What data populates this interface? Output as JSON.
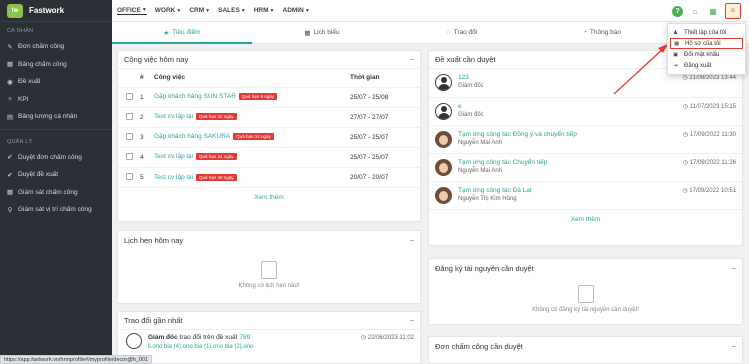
{
  "brand": {
    "name": "Fastwork",
    "logo_text": "fw"
  },
  "sidebar": {
    "section_personal": "CÁ NHÂN",
    "personal_items": [
      {
        "icon": "✎",
        "label": "Đơn chấm công"
      },
      {
        "icon": "▦",
        "label": "Bảng chấm công"
      },
      {
        "icon": "◉",
        "label": "Đề xuất"
      },
      {
        "icon": "✧",
        "label": "KPI"
      },
      {
        "icon": "▤",
        "label": "Bảng lương cá nhân"
      }
    ],
    "section_manage": "QUẢN LÝ",
    "manage_items": [
      {
        "icon": "✔",
        "label": "Duyệt đơn chấm công"
      },
      {
        "icon": "✔",
        "label": "Duyệt đề xuất"
      },
      {
        "icon": "▦",
        "label": "Giám sát chấm công"
      },
      {
        "icon": "⚲",
        "label": "Giám sát vị trí chấm công"
      }
    ]
  },
  "menu": [
    "OFFICE",
    "WORK",
    "CRM",
    "SALES",
    "HRM",
    "ADMIN"
  ],
  "tabs": [
    {
      "icon": "★",
      "label": "Tiêu điểm"
    },
    {
      "icon": "▦",
      "label": "Lịch biểu"
    },
    {
      "icon": "◌",
      "label": "Trao đổi"
    },
    {
      "icon": "◔",
      "label": "Thông báo"
    }
  ],
  "tasks": {
    "title": "Công việc hôm nay",
    "col_no": "#",
    "col_task": "Công việc",
    "col_time": "Thời gian",
    "rows": [
      {
        "no": "1",
        "name": "Gặp khách hàng SUN STAR",
        "badge": "Quá hạn 9 ngày",
        "time": "25/07 - 25/08"
      },
      {
        "no": "2",
        "name": "Test cv lặp lại",
        "badge": "Quá hạn 32 ngày",
        "time": "27/07 - 27/07"
      },
      {
        "no": "3",
        "name": "Gặp khách hàng SAKURA",
        "badge": "Quá hạn 34 ngày",
        "time": "25/07 - 25/07"
      },
      {
        "no": "4",
        "name": "Test cv lặp lại",
        "badge": "Quá hạn 34 ngày",
        "time": "25/07 - 25/07"
      },
      {
        "no": "5",
        "name": "Test cv lặp lại",
        "badge": "Quá hạn 39 ngày",
        "time": "20/07 - 20/07"
      }
    ],
    "see_more": "Xem thêm"
  },
  "meetings": {
    "title": "Lịch hẹn hôm nay",
    "empty": "Không có lịch hẹn nào!"
  },
  "recent": {
    "title": "Trao đổi gần nhất",
    "author": "Giám đốc",
    "text": "trao đổi trên đề xuất",
    "count": "789",
    "time": "22/06/2023 11:02",
    "line2": "ll.ono bia (4).ono bia (1).ono bia (2).ono"
  },
  "proposals": {
    "title": "Đề xuất cần duyệt",
    "items": [
      {
        "title": "123",
        "sub": "Giám đốc",
        "time": "21/08/2023 13:44",
        "avatar": "default"
      },
      {
        "title": "e",
        "sub": "Giám đốc",
        "time": "11/07/2023 15:15",
        "avatar": "default"
      },
      {
        "title": "Tạm ứng công tác Đồng ý và chuyển tiếp",
        "sub": "Nguyễn Mai Anh",
        "time": "17/09/2022 11:30",
        "avatar": "photo"
      },
      {
        "title": "Tạm ứng công tác Chuyển tiếp",
        "sub": "Nguyễn Mai Anh",
        "time": "17/09/2022 11:26",
        "avatar": "photo"
      },
      {
        "title": "Tạm ứng công tác Đà Lạt",
        "sub": "Nguyễn Thị Kim Hồng",
        "time": "17/09/2022 10:51",
        "avatar": "photo"
      }
    ],
    "see_more": "Xem thêm"
  },
  "resources": {
    "title": "Đăng ký tài nguyên cần duyệt",
    "empty": "Không có đăng ký tài nguyên cần duyệt!"
  },
  "timesheets": {
    "title": "Đơn chấm công cần duyệt"
  },
  "dropdown": {
    "items": [
      "Thiết lập của tôi",
      "Hồ sơ của tôi",
      "Đổi mật khẩu",
      "Đăng xuất"
    ]
  },
  "status_url": "https://app.fastwork.vn/hrmprofile#/myprofile/decor@h_001",
  "colors": {
    "accent": "#26a69a",
    "danger": "#e53935",
    "sidebar": "#2b3036"
  }
}
